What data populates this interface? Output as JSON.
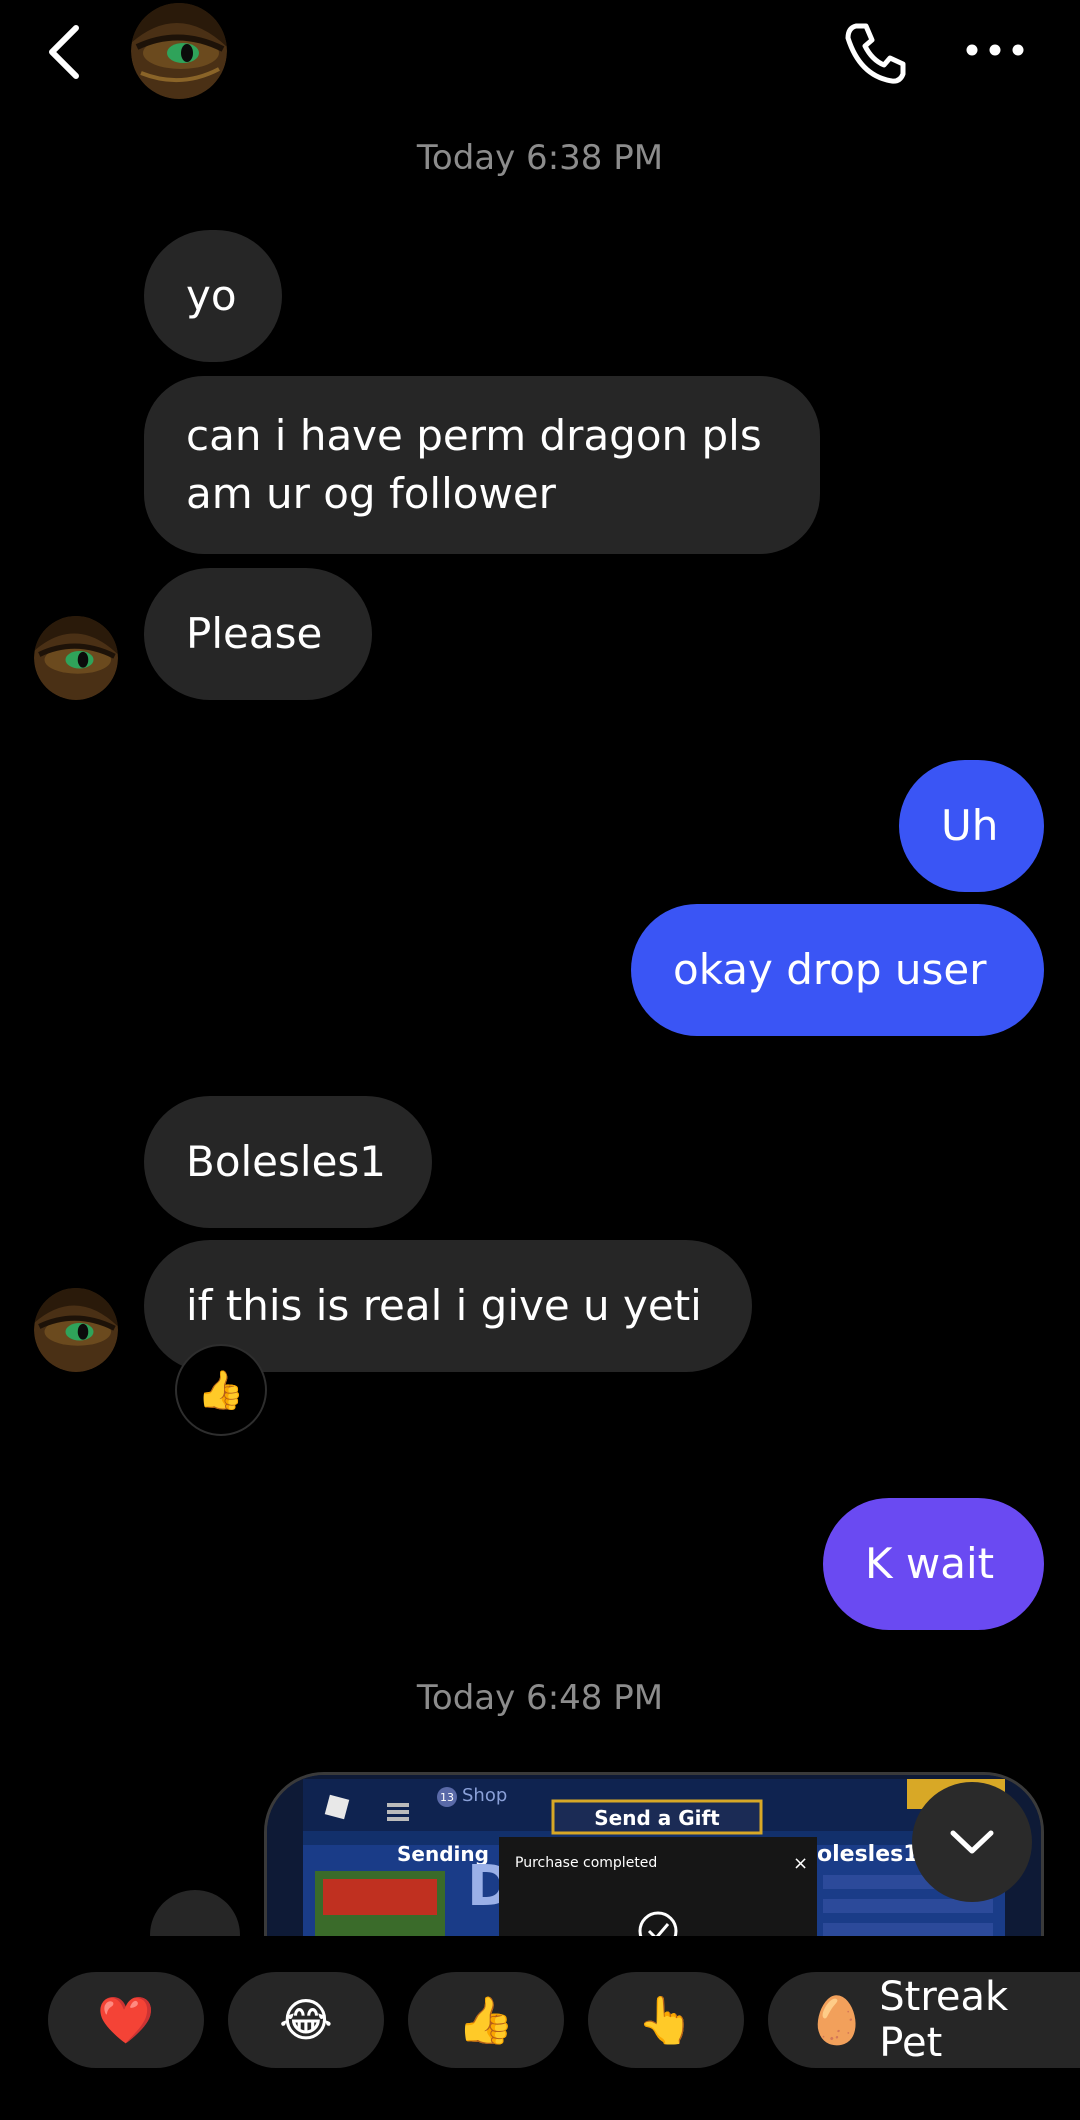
{
  "header": {
    "back_icon": "chevron-left-icon",
    "call_icon": "phone-icon",
    "more_icon": "more-horizontal-icon"
  },
  "timestamps": {
    "first": "Today 6:38 PM",
    "second": "Today 6:48 PM"
  },
  "messages": {
    "m1": "yo",
    "m2": "can i have perm dragon pls am ur og follower",
    "m3": "Please",
    "m4": "Uh",
    "m5": "okay drop user",
    "m6": "Bolesles1",
    "m7": "if this is real i give u yeti",
    "m7_reaction": "👍",
    "m8": "K wait"
  },
  "shared_image": {
    "shop_label": "Shop",
    "send_gift_label": "Send a Gift",
    "sending_label": "Sending",
    "recipient_label": "olesles1...",
    "purchase_label": "Purchase completed",
    "badge_count": "13"
  },
  "quick_replies": [
    {
      "emoji": "❤️"
    },
    {
      "emoji": "😂"
    },
    {
      "emoji": "👍"
    },
    {
      "emoji": "👆"
    },
    {
      "emoji": "🥚",
      "label": "Streak Pet"
    }
  ],
  "colors": {
    "incoming": "#262626",
    "outgoing_blue": "#3a55f5",
    "outgoing_purple": "#6a4af2",
    "timestamp": "#8c8c8c"
  }
}
